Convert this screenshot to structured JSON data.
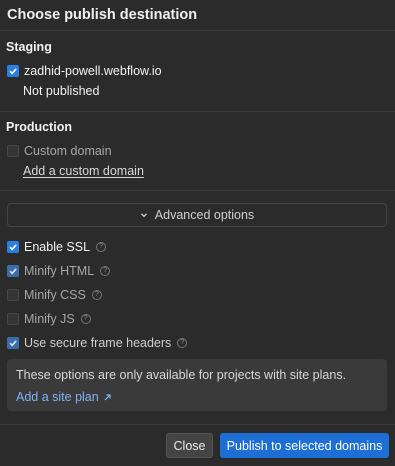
{
  "dialog": {
    "title": "Choose publish destination"
  },
  "staging": {
    "heading": "Staging",
    "domain": "zadhid-powell.webflow.io",
    "status": "Not published"
  },
  "production": {
    "heading": "Production",
    "custom_domain_label": "Custom domain",
    "add_domain_link": "Add a custom domain"
  },
  "advanced": {
    "toggle_label": "Advanced options",
    "options": [
      {
        "label": "Enable SSL",
        "checked": true
      },
      {
        "label": "Minify HTML",
        "checked": true
      },
      {
        "label": "Minify CSS",
        "checked": false
      },
      {
        "label": "Minify JS",
        "checked": false
      },
      {
        "label": "Use secure frame headers",
        "checked": true
      }
    ],
    "help_glyph": "?",
    "note": "These options are only available for projects with site plans.",
    "note_link": "Add a site plan"
  },
  "footer": {
    "close_label": "Close",
    "publish_label": "Publish to selected domains"
  },
  "colors": {
    "accent": "#1d6fd6",
    "link": "#7db4f5",
    "background": "#2b2b2b"
  }
}
